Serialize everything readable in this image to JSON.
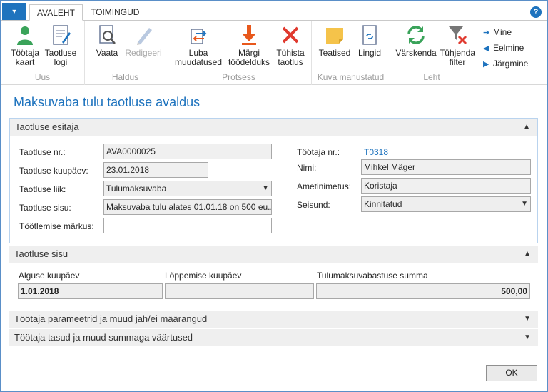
{
  "tabs": {
    "active": "AVALEHT",
    "other": "TOIMINGUD"
  },
  "help_label": "?",
  "ribbon": {
    "groups": {
      "uus": "Uus",
      "haldus": "Haldus",
      "protsess": "Protsess",
      "manustatud": "Kuva manustatud",
      "leht": "Leht"
    },
    "buttons": {
      "tootaja_kaart": [
        "Töötaja",
        "kaart"
      ],
      "taotluse_logi": [
        "Taotluse",
        "logi"
      ],
      "vaata": "Vaata",
      "redigeeri": "Redigeeri",
      "luba_muudatused": [
        "Luba",
        "muudatused"
      ],
      "margi_tooldeldud": [
        "Märgi",
        "töödelduks"
      ],
      "tuhista_taotlus": [
        "Tühista",
        "taotlus"
      ],
      "teatised": "Teatised",
      "lingid": "Lingid",
      "varskenda": "Värskenda",
      "tuhjenda_filter": [
        "Tühjenda",
        "filter"
      ],
      "mine": "Mine",
      "eelmine": "Eelmine",
      "jargmine": "Järgmine"
    }
  },
  "page_title": "Maksuvaba tulu taotluse avaldus",
  "sections": {
    "esitaja": "Taotluse esitaja",
    "sisu": "Taotluse sisu",
    "parameetrid": "Töötaja parameetrid ja muud jah/ei määrangud",
    "tasud": "Töötaja tasud ja muud summaga väärtused"
  },
  "esitaja": {
    "taotluse_nr_label": "Taotluse nr.:",
    "taotluse_nr": "AVA0000025",
    "kuupaev_label": "Taotluse kuupäev:",
    "kuupaev": "23.01.2018",
    "liik_label": "Taotluse liik:",
    "liik": "Tulumaksuvaba",
    "sisu_label": "Taotluse sisu:",
    "sisu": "Maksuvaba tulu alates 01.01.18 on 500 eu...",
    "markus_label": "Töötlemise märkus:",
    "markus": "",
    "tootaja_nr_label": "Töötaja nr.:",
    "tootaja_nr": "T0318",
    "nimi_label": "Nimi:",
    "nimi": "Mihkel Mäger",
    "ametinimetus_label": "Ametinimetus:",
    "ametinimetus": "Koristaja",
    "seisund_label": "Seisund:",
    "seisund": "Kinnitatud"
  },
  "sisu": {
    "algus_label": "Alguse kuupäev",
    "algus": "1.01.2018",
    "lopp_label": "Lõppemise kuupäev",
    "lopp": "",
    "summa_label": "Tulumaksuvabastuse summa",
    "summa": "500,00"
  },
  "ok_label": "OK",
  "colors": {
    "accent": "#1e73be",
    "orange_arrow": "#e8581c",
    "red_x": "#e03a2f",
    "green": "#3aa35a"
  }
}
